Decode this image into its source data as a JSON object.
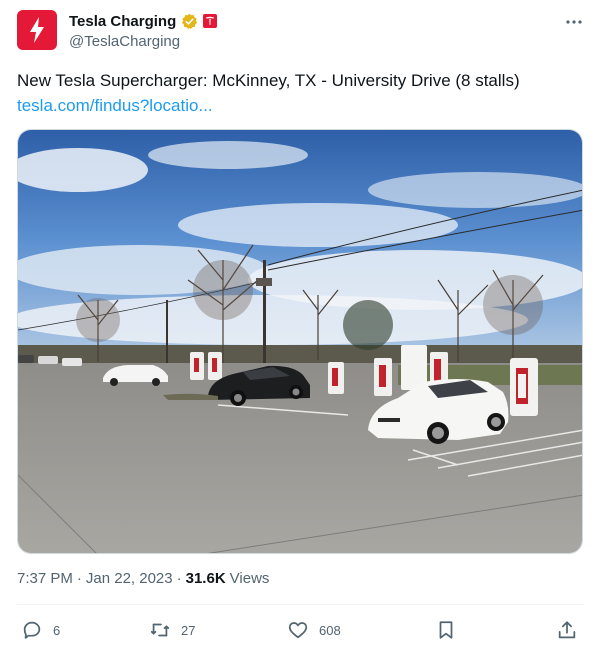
{
  "author": {
    "display_name": "Tesla Charging",
    "handle": "@TeslaCharging",
    "avatar_icon": "lightning-bolt-icon",
    "verified_icon": "gold-verified-badge-icon",
    "affiliate_icon": "tesla-logo-icon",
    "brand_color": "#e31937"
  },
  "tweet": {
    "text": "New Tesla Supercharger: McKinney, TX - University Drive (8 stalls)",
    "link_text": "tesla.com/findus?locatio..."
  },
  "media": {
    "description_icon": "supercharger-photo"
  },
  "meta": {
    "time": "7:37 PM",
    "separator": "·",
    "date": "Jan 22, 2023",
    "separator2": "·",
    "views_count": "31.6K",
    "views_label": "Views"
  },
  "actions": {
    "replies": "6",
    "retweets": "27",
    "likes": "608"
  },
  "colors": {
    "text_primary": "#0f1419",
    "text_secondary": "#536471",
    "link": "#1d9bf0",
    "divider": "#eff3f4"
  }
}
